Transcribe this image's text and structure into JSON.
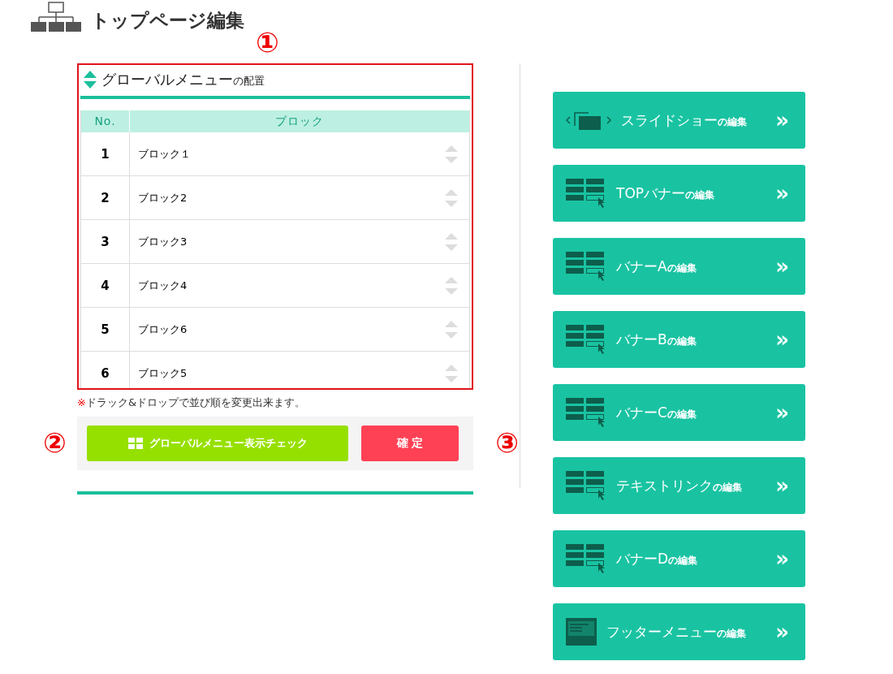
{
  "page": {
    "title": "トップページ編集"
  },
  "annotations": [
    "①",
    "②",
    "③"
  ],
  "panel": {
    "title": "グローバルメニュー",
    "title_suffix": "の配置",
    "columns": [
      "No.",
      "ブロック"
    ],
    "rows": [
      {
        "no": "1",
        "block": "ブロック１"
      },
      {
        "no": "2",
        "block": "ブロック2"
      },
      {
        "no": "3",
        "block": "ブロック3"
      },
      {
        "no": "4",
        "block": "ブロック4"
      },
      {
        "no": "5",
        "block": "ブロック6"
      },
      {
        "no": "6",
        "block": "ブロック5"
      }
    ],
    "note_mark": "※",
    "note": "ドラック&ドロップで並び順を変更出来ます。",
    "check_button": "グローバルメニュー表示チェック",
    "confirm_button": "確 定"
  },
  "edit_buttons": [
    {
      "kind": "slideshow",
      "label": "スライドショー",
      "suffix": "の編集",
      "arrow": "»"
    },
    {
      "kind": "banner",
      "label": "TOPバナー",
      "suffix": "の編集",
      "arrow": "»"
    },
    {
      "kind": "banner",
      "label": "バナーA",
      "suffix": "の編集",
      "arrow": "»"
    },
    {
      "kind": "banner",
      "label": "バナーB",
      "suffix": "の編集",
      "arrow": "»"
    },
    {
      "kind": "banner",
      "label": "バナーC",
      "suffix": "の編集",
      "arrow": "»"
    },
    {
      "kind": "banner",
      "label": "テキストリンク",
      "suffix": "の編集",
      "arrow": "»"
    },
    {
      "kind": "banner",
      "label": "バナーD",
      "suffix": "の編集",
      "arrow": "»"
    },
    {
      "kind": "footer",
      "label": "フッターメニュー",
      "suffix": "の編集",
      "arrow": "»"
    }
  ]
}
